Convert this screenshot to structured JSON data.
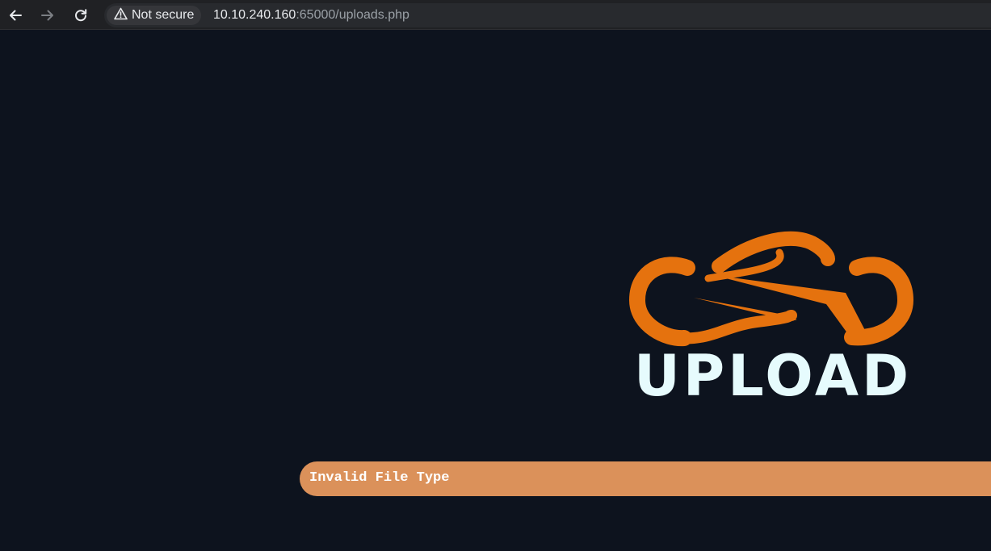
{
  "browser": {
    "security_label": "Not secure",
    "url_host": "10.10.240.160",
    "url_rest": ":65000/uploads.php",
    "icons": {
      "back": "back-arrow-icon",
      "forward": "forward-arrow-icon",
      "reload": "reload-icon",
      "security": "warning-triangle-icon"
    }
  },
  "page": {
    "logo_word": "UPLOAD",
    "alert_message": "Invalid File Type"
  },
  "colors": {
    "page_background": "#0d131e",
    "logo_orange": "#e5720e",
    "logo_text": "#e6fbfd",
    "alert_background": "#db915a",
    "alert_text": "#ffffff"
  }
}
